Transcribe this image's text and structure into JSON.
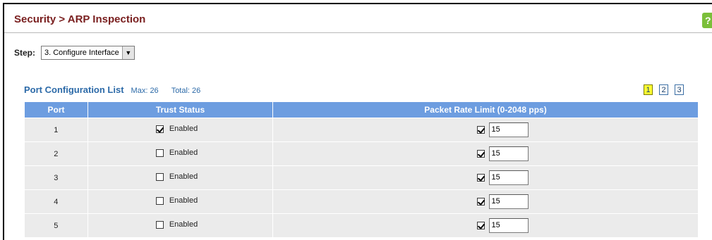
{
  "header": {
    "title": "Security > ARP Inspection",
    "help_glyph": "?"
  },
  "step": {
    "label": "Step:",
    "selected": "3. Configure Interface"
  },
  "list": {
    "title": "Port Configuration List",
    "max": "Max: 26",
    "total": "Total: 26",
    "pages": [
      "1",
      "2",
      "3"
    ],
    "active_page": "1"
  },
  "table": {
    "columns": [
      "Port",
      "Trust Status",
      "Packet Rate Limit (0-2048 pps)"
    ],
    "rows": [
      {
        "port": "1",
        "trust_checked": true,
        "trust_label": "Enabled",
        "rate_checked": true,
        "rate": "15"
      },
      {
        "port": "2",
        "trust_checked": false,
        "trust_label": "Enabled",
        "rate_checked": true,
        "rate": "15"
      },
      {
        "port": "3",
        "trust_checked": false,
        "trust_label": "Enabled",
        "rate_checked": true,
        "rate": "15"
      },
      {
        "port": "4",
        "trust_checked": false,
        "trust_label": "Enabled",
        "rate_checked": true,
        "rate": "15"
      },
      {
        "port": "5",
        "trust_checked": false,
        "trust_label": "Enabled",
        "rate_checked": true,
        "rate": "15"
      }
    ]
  },
  "colors": {
    "title": "#7a2020",
    "header_bg": "#6d9de0",
    "row_bg": "#ebebeb",
    "link_blue": "#2c6aa8",
    "active_page": "#ffff33"
  }
}
